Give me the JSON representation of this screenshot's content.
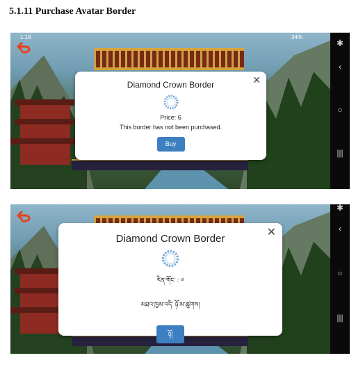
{
  "heading": "5.1.11 Purchase Avatar Border",
  "colors": {
    "accent": "#3e7fc1",
    "modal_bg": "#ffffff",
    "navbar_bg": "#0a0a0a"
  },
  "screens": [
    {
      "status_time": "1:18",
      "status_right": "34%",
      "dialog": {
        "title": "Diamond Crown Border",
        "border_icon": "diamond-crown-border-icon",
        "price": "Price: 6",
        "status": "This border has not been purchased.",
        "buy_label": "Buy",
        "close_icon": "close-icon"
      }
    },
    {
      "dialog": {
        "title": "Diamond Crown Border",
        "border_icon": "diamond-crown-border-icon",
        "price": "རིན་གོང་ : ༦",
        "status": "མཐའ་ཁྱམ་འདི་ ཉོ་མ་ཚུགས།",
        "buy_label": "ཉོ།",
        "close_icon": "close-icon"
      }
    }
  ]
}
